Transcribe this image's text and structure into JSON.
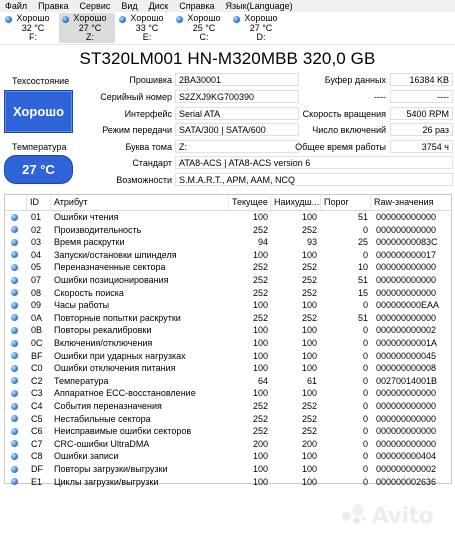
{
  "menu": [
    "Файл",
    "Правка",
    "Сервис",
    "Вид",
    "Диск",
    "Справка",
    "Язык(Language)"
  ],
  "drives": [
    {
      "status": "Хорошо",
      "temp": "32 °C",
      "letter": "F:",
      "selected": false
    },
    {
      "status": "Хорошо",
      "temp": "27 °C",
      "letter": "Z:",
      "selected": true
    },
    {
      "status": "Хорошо",
      "temp": "33 °C",
      "letter": "E:",
      "selected": false
    },
    {
      "status": "Хорошо",
      "temp": "25 °C",
      "letter": "C:",
      "selected": false
    },
    {
      "status": "Хорошо",
      "temp": "27 °C",
      "letter": "D:",
      "selected": false
    }
  ],
  "title": "ST320LM001 HN-M320MBB 320,0 GB",
  "left": {
    "tech_label": "Техсостояние",
    "health": "Хорошо",
    "temp_label": "Температура",
    "temp": "27 °C"
  },
  "info": {
    "firmware_label": "Прошивка",
    "firmware": "2BA30001",
    "serial_label": "Серийный номер",
    "serial": "S2ZXJ9KG700390",
    "interface_label": "Интерфейс",
    "interface": "Serial ATA",
    "transfer_label": "Режим передачи",
    "transfer": "SATA/300 | SATA/600",
    "volume_label": "Буква тома",
    "volume": "Z:",
    "standard_label": "Стандарт",
    "standard": "ATA8-ACS | ATA8-ACS version 6",
    "features_label": "Возможности",
    "features": "S.M.A.R.T., APM, AAM, NCQ",
    "buffer_label": "Буфер данных",
    "buffer": "16384 KB",
    "blank1_label": "----",
    "blank1": "----",
    "rpm_label": "Скорость вращения",
    "rpm": "5400 RPM",
    "power_count_label": "Число включений",
    "power_count": "26 раз",
    "hours_label": "Общее время работы",
    "hours": "3754 ч"
  },
  "table": {
    "headers": [
      "ID",
      "Атрибут",
      "Текущее",
      "Наихудш...",
      "Порог",
      "Raw-значения"
    ],
    "rows": [
      {
        "id": "01",
        "name": "Ошибки чтения",
        "cur": "100",
        "worst": "100",
        "thr": "51",
        "raw": "000000000000"
      },
      {
        "id": "02",
        "name": "Производительность",
        "cur": "252",
        "worst": "252",
        "thr": "0",
        "raw": "000000000000"
      },
      {
        "id": "03",
        "name": "Время раскрутки",
        "cur": "94",
        "worst": "93",
        "thr": "25",
        "raw": "00000000083C"
      },
      {
        "id": "04",
        "name": "Запуски/остановки шпинделя",
        "cur": "100",
        "worst": "100",
        "thr": "0",
        "raw": "000000000017"
      },
      {
        "id": "05",
        "name": "Переназначенные сектора",
        "cur": "252",
        "worst": "252",
        "thr": "10",
        "raw": "000000000000"
      },
      {
        "id": "07",
        "name": "Ошибки позиционирования",
        "cur": "252",
        "worst": "252",
        "thr": "51",
        "raw": "000000000000"
      },
      {
        "id": "08",
        "name": "Скорость поиска",
        "cur": "252",
        "worst": "252",
        "thr": "15",
        "raw": "000000000000"
      },
      {
        "id": "09",
        "name": "Часы работы",
        "cur": "100",
        "worst": "100",
        "thr": "0",
        "raw": "000000000EAA"
      },
      {
        "id": "0A",
        "name": "Повторные попытки раскрутки",
        "cur": "252",
        "worst": "252",
        "thr": "51",
        "raw": "000000000000"
      },
      {
        "id": "0B",
        "name": "Повторы рекалибровки",
        "cur": "100",
        "worst": "100",
        "thr": "0",
        "raw": "000000000002"
      },
      {
        "id": "0C",
        "name": "Включения/отключения",
        "cur": "100",
        "worst": "100",
        "thr": "0",
        "raw": "00000000001A"
      },
      {
        "id": "BF",
        "name": "Ошибки при ударных нагрузках",
        "cur": "100",
        "worst": "100",
        "thr": "0",
        "raw": "000000000045"
      },
      {
        "id": "C0",
        "name": "Ошибки отключения питания",
        "cur": "100",
        "worst": "100",
        "thr": "0",
        "raw": "000000000008"
      },
      {
        "id": "C2",
        "name": "Температура",
        "cur": "64",
        "worst": "61",
        "thr": "0",
        "raw": "00270014001B"
      },
      {
        "id": "C3",
        "name": "Аппаратное ECC-восстановление",
        "cur": "100",
        "worst": "100",
        "thr": "0",
        "raw": "000000000000"
      },
      {
        "id": "C4",
        "name": "События переназначения",
        "cur": "252",
        "worst": "252",
        "thr": "0",
        "raw": "000000000000"
      },
      {
        "id": "C5",
        "name": "Нестабильные сектора",
        "cur": "252",
        "worst": "252",
        "thr": "0",
        "raw": "000000000000"
      },
      {
        "id": "C6",
        "name": "Неисправимые ошибки секторов",
        "cur": "252",
        "worst": "252",
        "thr": "0",
        "raw": "000000000000"
      },
      {
        "id": "C7",
        "name": "CRC-ошибки UltraDMA",
        "cur": "200",
        "worst": "200",
        "thr": "0",
        "raw": "000000000000"
      },
      {
        "id": "C8",
        "name": "Ошибки записи",
        "cur": "100",
        "worst": "100",
        "thr": "0",
        "raw": "000000000404"
      },
      {
        "id": "DF",
        "name": "Повторы загрузки/выгрузки",
        "cur": "100",
        "worst": "100",
        "thr": "0",
        "raw": "000000000002"
      },
      {
        "id": "E1",
        "name": "Циклы загрузки/выгрузки",
        "cur": "100",
        "worst": "100",
        "thr": "0",
        "raw": "000000002636"
      }
    ]
  },
  "watermark": {
    "text": "Avito"
  },
  "colors": {
    "health_blue": "#2f64d8",
    "status_dot": "#3b84e0"
  }
}
